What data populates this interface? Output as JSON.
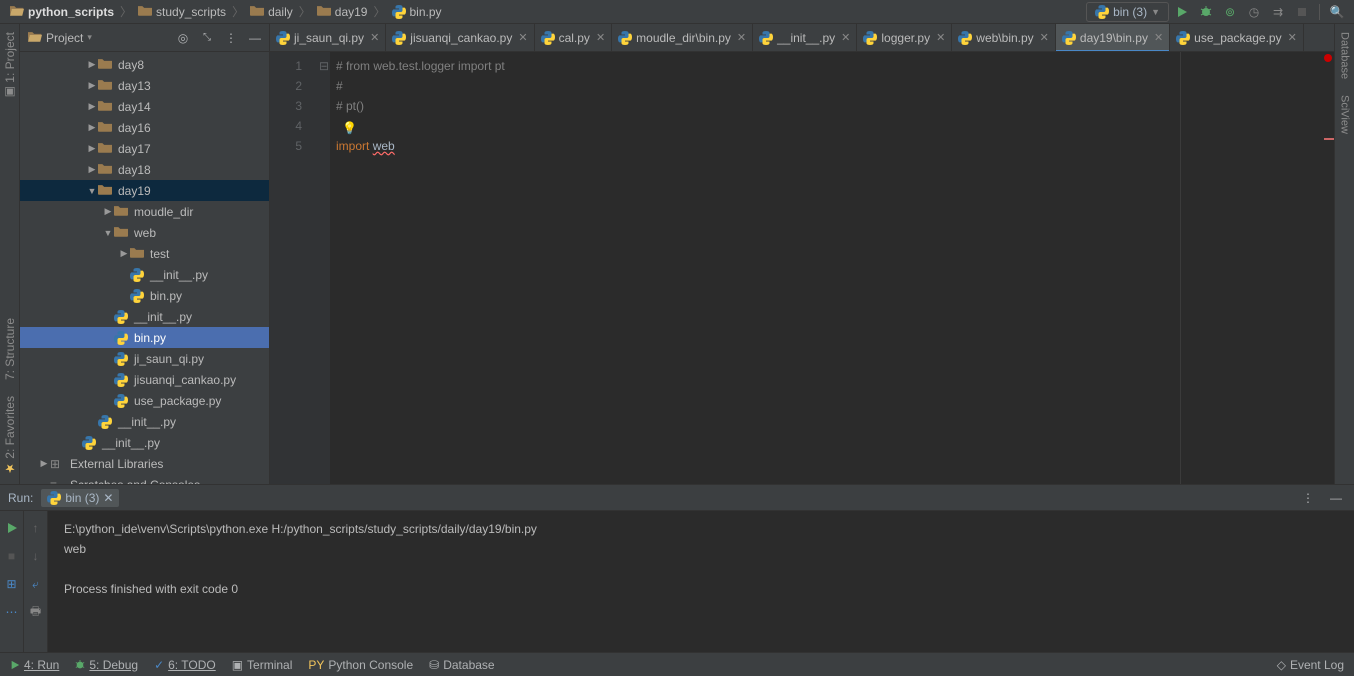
{
  "breadcrumb": [
    {
      "icon": "folder-open",
      "label": "python_scripts",
      "bold": true
    },
    {
      "icon": "folder",
      "label": "study_scripts"
    },
    {
      "icon": "folder",
      "label": "daily"
    },
    {
      "icon": "folder",
      "label": "day19"
    },
    {
      "icon": "python",
      "label": "bin.py"
    }
  ],
  "run_config_label": "bin (3)",
  "project_panel_title": "Project",
  "tree": [
    {
      "depth": 3,
      "arrow": "▶",
      "icon": "folder",
      "label": "day8"
    },
    {
      "depth": 3,
      "arrow": "▶",
      "icon": "folder",
      "label": "day13"
    },
    {
      "depth": 3,
      "arrow": "▶",
      "icon": "folder",
      "label": "day14"
    },
    {
      "depth": 3,
      "arrow": "▶",
      "icon": "folder",
      "label": "day16"
    },
    {
      "depth": 3,
      "arrow": "▶",
      "icon": "folder",
      "label": "day17"
    },
    {
      "depth": 3,
      "arrow": "▶",
      "icon": "folder",
      "label": "day18"
    },
    {
      "depth": 3,
      "arrow": "▼",
      "icon": "folder",
      "label": "day19",
      "sel": true
    },
    {
      "depth": 4,
      "arrow": "▶",
      "icon": "folder",
      "label": "moudle_dir"
    },
    {
      "depth": 4,
      "arrow": "▼",
      "icon": "package",
      "label": "web"
    },
    {
      "depth": 5,
      "arrow": "▶",
      "icon": "folder",
      "label": "test"
    },
    {
      "depth": 5,
      "arrow": "",
      "icon": "python",
      "label": "__init__.py"
    },
    {
      "depth": 5,
      "arrow": "",
      "icon": "python",
      "label": "bin.py"
    },
    {
      "depth": 4,
      "arrow": "",
      "icon": "python",
      "label": "__init__.py"
    },
    {
      "depth": 4,
      "arrow": "",
      "icon": "python",
      "label": "bin.py",
      "hl": true
    },
    {
      "depth": 4,
      "arrow": "",
      "icon": "python",
      "label": "ji_saun_qi.py"
    },
    {
      "depth": 4,
      "arrow": "",
      "icon": "python",
      "label": "jisuanqi_cankao.py"
    },
    {
      "depth": 4,
      "arrow": "",
      "icon": "python",
      "label": "use_package.py"
    },
    {
      "depth": 3,
      "arrow": "",
      "icon": "python",
      "label": "__init__.py"
    },
    {
      "depth": 2,
      "arrow": "",
      "icon": "python",
      "label": "__init__.py"
    },
    {
      "depth": 0,
      "arrow": "▶",
      "icon": "lib",
      "label": "External Libraries"
    },
    {
      "depth": 0,
      "arrow": "",
      "icon": "scratch",
      "label": "Scratches and Consoles"
    }
  ],
  "left_tabs": {
    "project": "1: Project",
    "structure": "7: Structure",
    "favorites": "2: Favorites"
  },
  "right_tabs": {
    "database": "Database",
    "sciview": "SciView"
  },
  "editor_tabs": [
    {
      "label": "ji_saun_qi.py"
    },
    {
      "label": "jisuanqi_cankao.py"
    },
    {
      "label": "cal.py"
    },
    {
      "label": "moudle_dir\\bin.py"
    },
    {
      "label": "__init__.py"
    },
    {
      "label": "logger.py"
    },
    {
      "label": "web\\bin.py"
    },
    {
      "label": "day19\\bin.py",
      "active": true
    },
    {
      "label": "use_package.py"
    }
  ],
  "code_lines": [
    {
      "n": "1",
      "html": "<span class='cmt'># from web.test.logger import pt</span>"
    },
    {
      "n": "2",
      "html": "<span class='cmt'>#</span>"
    },
    {
      "n": "3",
      "html": "<span class='cmt'># pt()</span>"
    },
    {
      "n": "4",
      "html": ""
    },
    {
      "n": "5",
      "html": "<span class='kw'>import</span> <span class='err'>web</span>"
    }
  ],
  "run": {
    "title": "Run:",
    "tab": "bin (3)",
    "output": [
      "E:\\python_ide\\venv\\Scripts\\python.exe H:/python_scripts/study_scripts/daily/day19/bin.py",
      "web",
      "",
      "Process finished with exit code 0"
    ]
  },
  "status": {
    "run": "4: Run",
    "debug": "5: Debug",
    "todo": "6: TODO",
    "terminal": "Terminal",
    "pyconsole": "Python Console",
    "database": "Database",
    "eventlog": "Event Log"
  }
}
